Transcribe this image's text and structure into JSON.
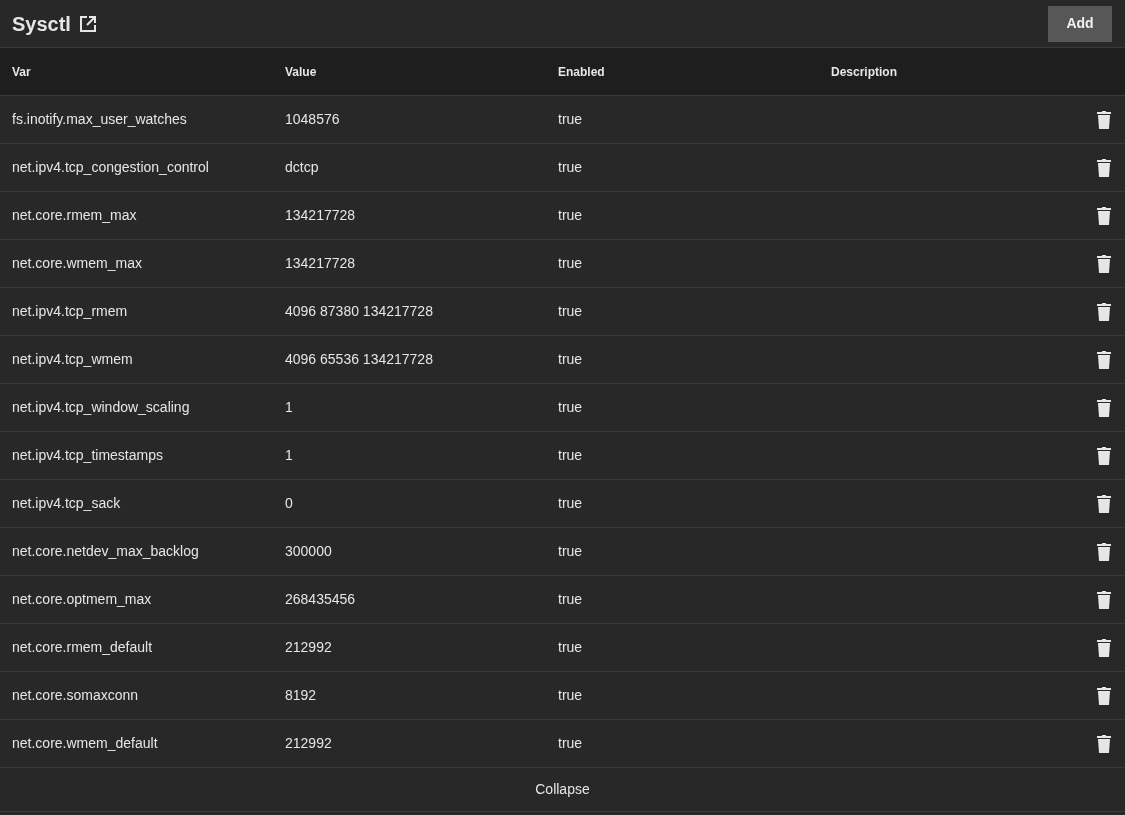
{
  "card": {
    "title": "Sysctl",
    "add_button": "Add"
  },
  "table": {
    "columns": [
      "Var",
      "Value",
      "Enabled",
      "Description"
    ],
    "rows": [
      {
        "var": "fs.inotify.max_user_watches",
        "value": "1048576",
        "enabled": "true"
      },
      {
        "var": "net.ipv4.tcp_congestion_control",
        "value": "dctcp",
        "enabled": "true"
      },
      {
        "var": "net.core.rmem_max",
        "value": "134217728",
        "enabled": "true"
      },
      {
        "var": "net.core.wmem_max",
        "value": "134217728",
        "enabled": "true"
      },
      {
        "var": "net.ipv4.tcp_rmem",
        "value": "4096 87380 134217728",
        "enabled": "true"
      },
      {
        "var": "net.ipv4.tcp_wmem",
        "value": "4096 65536 134217728",
        "enabled": "true"
      },
      {
        "var": "net.ipv4.tcp_window_scaling",
        "value": "1",
        "enabled": "true"
      },
      {
        "var": "net.ipv4.tcp_timestamps",
        "value": "1",
        "enabled": "true"
      },
      {
        "var": "net.ipv4.tcp_sack",
        "value": "0",
        "enabled": "true"
      },
      {
        "var": "net.core.netdev_max_backlog",
        "value": "300000",
        "enabled": "true"
      },
      {
        "var": "net.core.optmem_max",
        "value": "268435456",
        "enabled": "true"
      },
      {
        "var": "net.core.rmem_default",
        "value": "212992",
        "enabled": "true"
      },
      {
        "var": "net.core.somaxconn",
        "value": "8192",
        "enabled": "true"
      },
      {
        "var": "net.core.wmem_default",
        "value": "212992",
        "enabled": "true"
      }
    ]
  },
  "footer": {
    "collapse": "Collapse"
  }
}
